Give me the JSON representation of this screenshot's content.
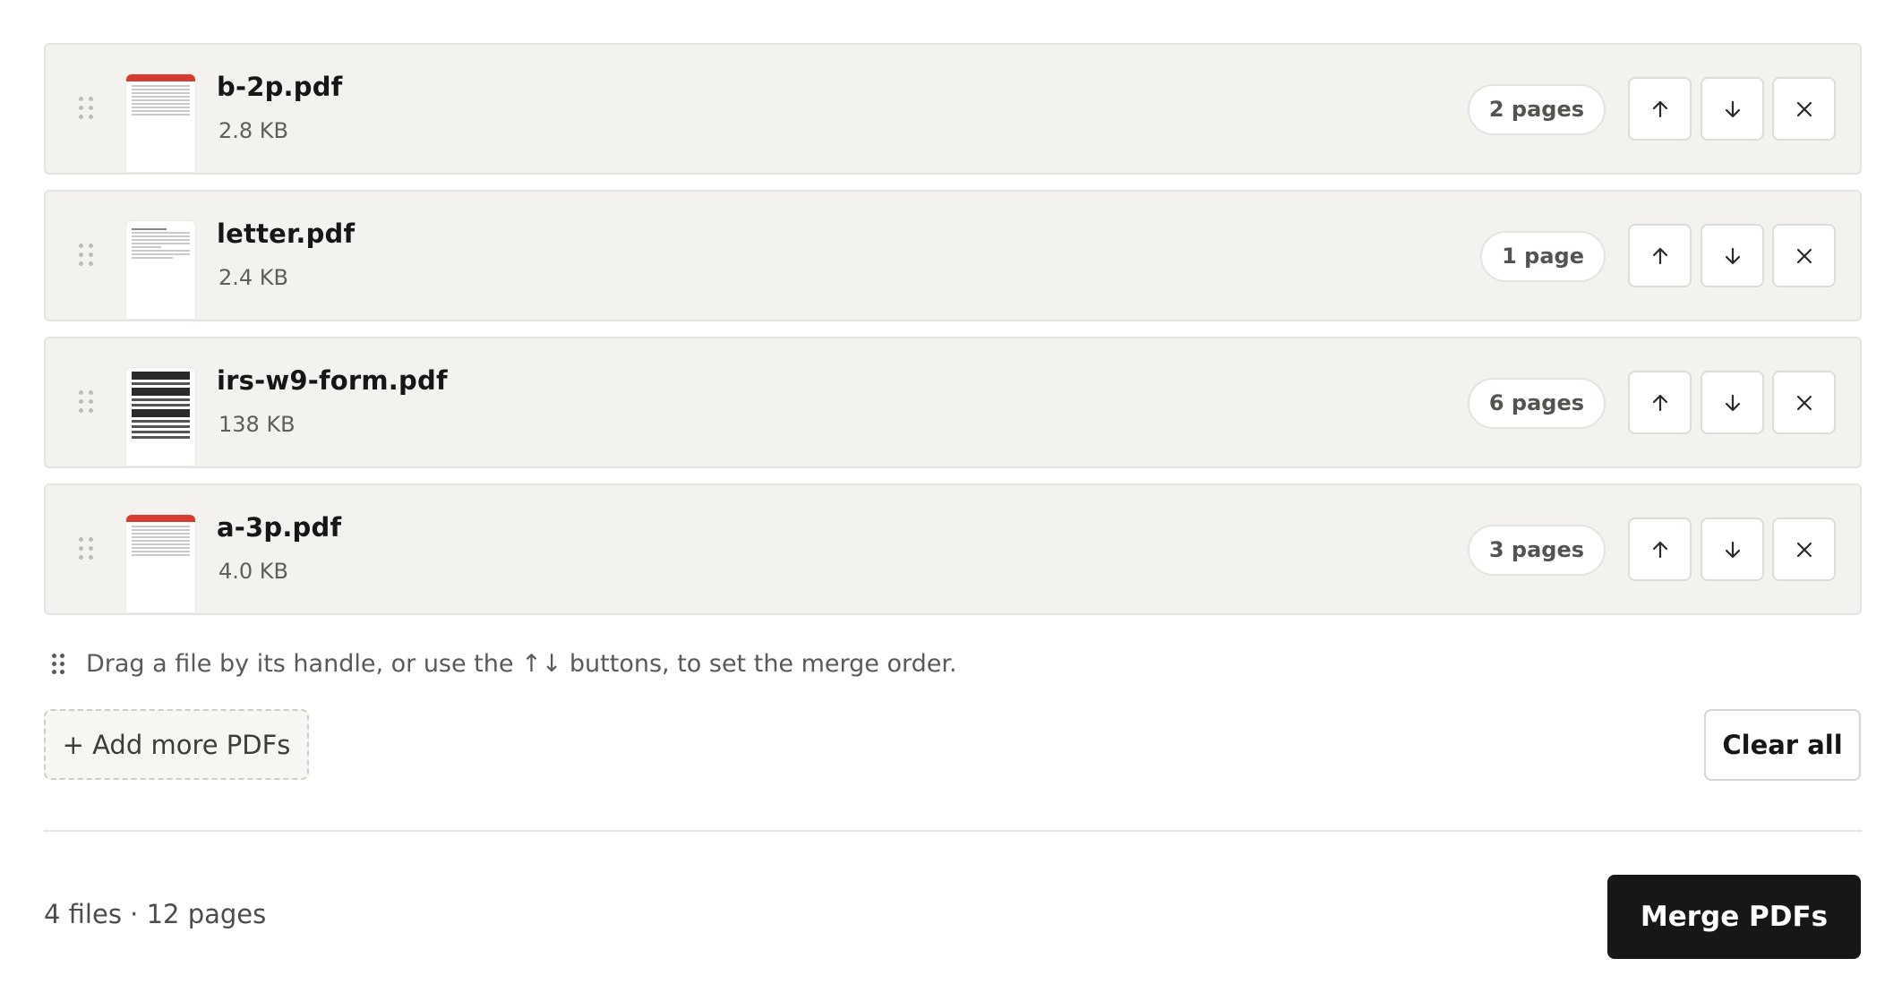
{
  "files": [
    {
      "name": "b-2p.pdf",
      "size": "2.8 KB",
      "pages": "2 pages",
      "thumb": "red-header-doc"
    },
    {
      "name": "letter.pdf",
      "size": "2.4 KB",
      "pages": "1 page",
      "thumb": "plain-letter"
    },
    {
      "name": "irs-w9-form.pdf",
      "size": "138 KB",
      "pages": "6 pages",
      "thumb": "form"
    },
    {
      "name": "a-3p.pdf",
      "size": "4.0 KB",
      "pages": "3 pages",
      "thumb": "red-header-doc"
    }
  ],
  "row_icons": {
    "drag": "drag-handle-icon",
    "up": "arrow-up-icon",
    "down": "arrow-down-icon",
    "remove": "close-icon"
  },
  "hint": {
    "text": "Drag a file by its handle, or use the ↑↓ buttons, to set the merge order."
  },
  "actions": {
    "add_more": "+ Add more PDFs",
    "clear_all": "Clear all",
    "merge": "Merge PDFs"
  },
  "summary": "4 files · 12 pages",
  "colors": {
    "row_bg": "#f3f2ef",
    "primary_button": "#171717",
    "thumb_accent": "#d63b2f"
  }
}
